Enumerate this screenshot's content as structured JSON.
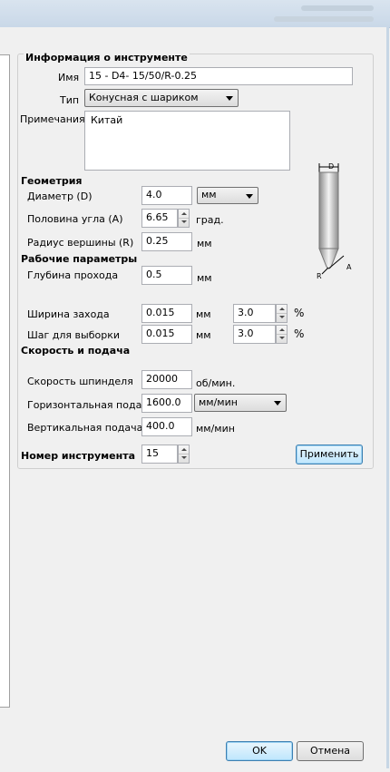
{
  "tool_info": {
    "section_title": "Информация о инструменте",
    "name_label": "Имя",
    "name_value": "15  - D4- 15/50/R-0.25",
    "type_label": "Тип",
    "type_value": "Конусная с шариком",
    "notes_label": "Примечания",
    "notes_value": "Китай"
  },
  "geometry": {
    "section_title": "Геометрия",
    "diameter_label": "Диаметр (D)",
    "diameter_value": "4.0",
    "diameter_unit": "мм",
    "half_angle_label": "Половина угла (A)",
    "half_angle_value": "6.65",
    "half_angle_unit": "град.",
    "tip_radius_label": "Радиус вершины (R)",
    "tip_radius_value": "0.25",
    "tip_radius_unit": "мм"
  },
  "diagram": {
    "d_label": "D",
    "a_label": "A",
    "r_label": "R"
  },
  "working": {
    "section_title": "Рабочие параметры",
    "pass_depth_label": "Глубина прохода",
    "pass_depth_value": "0.5",
    "pass_depth_unit": "мм",
    "stepover_label": "Ширина захода",
    "stepover_value": "0.015",
    "stepover_unit": "мм",
    "stepover_percent": "3.0",
    "stepover_percent_unit": "%",
    "clearance_step_label": "Шаг для выборки",
    "clearance_step_value": "0.015",
    "clearance_step_unit": "мм",
    "clearance_step_percent": "3.0",
    "clearance_step_percent_unit": "%"
  },
  "speed": {
    "section_title": "Скорость и подача",
    "spindle_label": "Скорость шпинделя",
    "spindle_value": "20000",
    "spindle_unit": "об/мин.",
    "feed_label": "Горизонтальная подача",
    "feed_value": "1600.0",
    "feed_unit": "мм/мин",
    "plunge_label": "Вертикальная подача",
    "plunge_value": "400.0",
    "plunge_unit": "мм/мин"
  },
  "tool_number": {
    "label": "Номер инструмента",
    "value": "15"
  },
  "buttons": {
    "apply": "Применить",
    "ok": "OK",
    "cancel": "Отмена"
  }
}
